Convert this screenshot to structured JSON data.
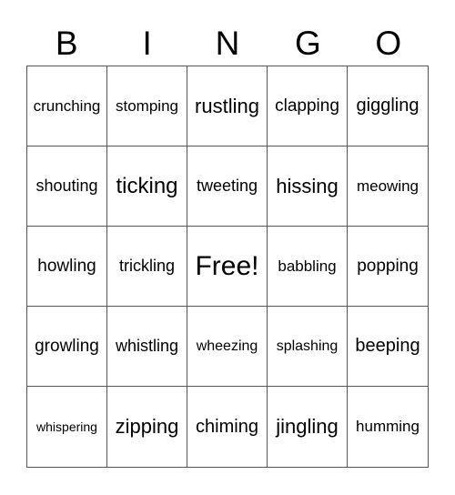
{
  "header": {
    "letters": [
      "B",
      "I",
      "N",
      "G",
      "O"
    ]
  },
  "grid": {
    "rows": [
      [
        "crunching",
        "stomping",
        "rustling",
        "clapping",
        "giggling"
      ],
      [
        "shouting",
        "ticking",
        "tweeting",
        "hissing",
        "meowing"
      ],
      [
        "howling",
        "trickling",
        "Free!",
        "babbling",
        "popping"
      ],
      [
        "growling",
        "whistling",
        "wheezing",
        "splashing",
        "beeping"
      ],
      [
        "whispering",
        "zipping",
        "chiming",
        "jingling",
        "humming"
      ]
    ]
  }
}
